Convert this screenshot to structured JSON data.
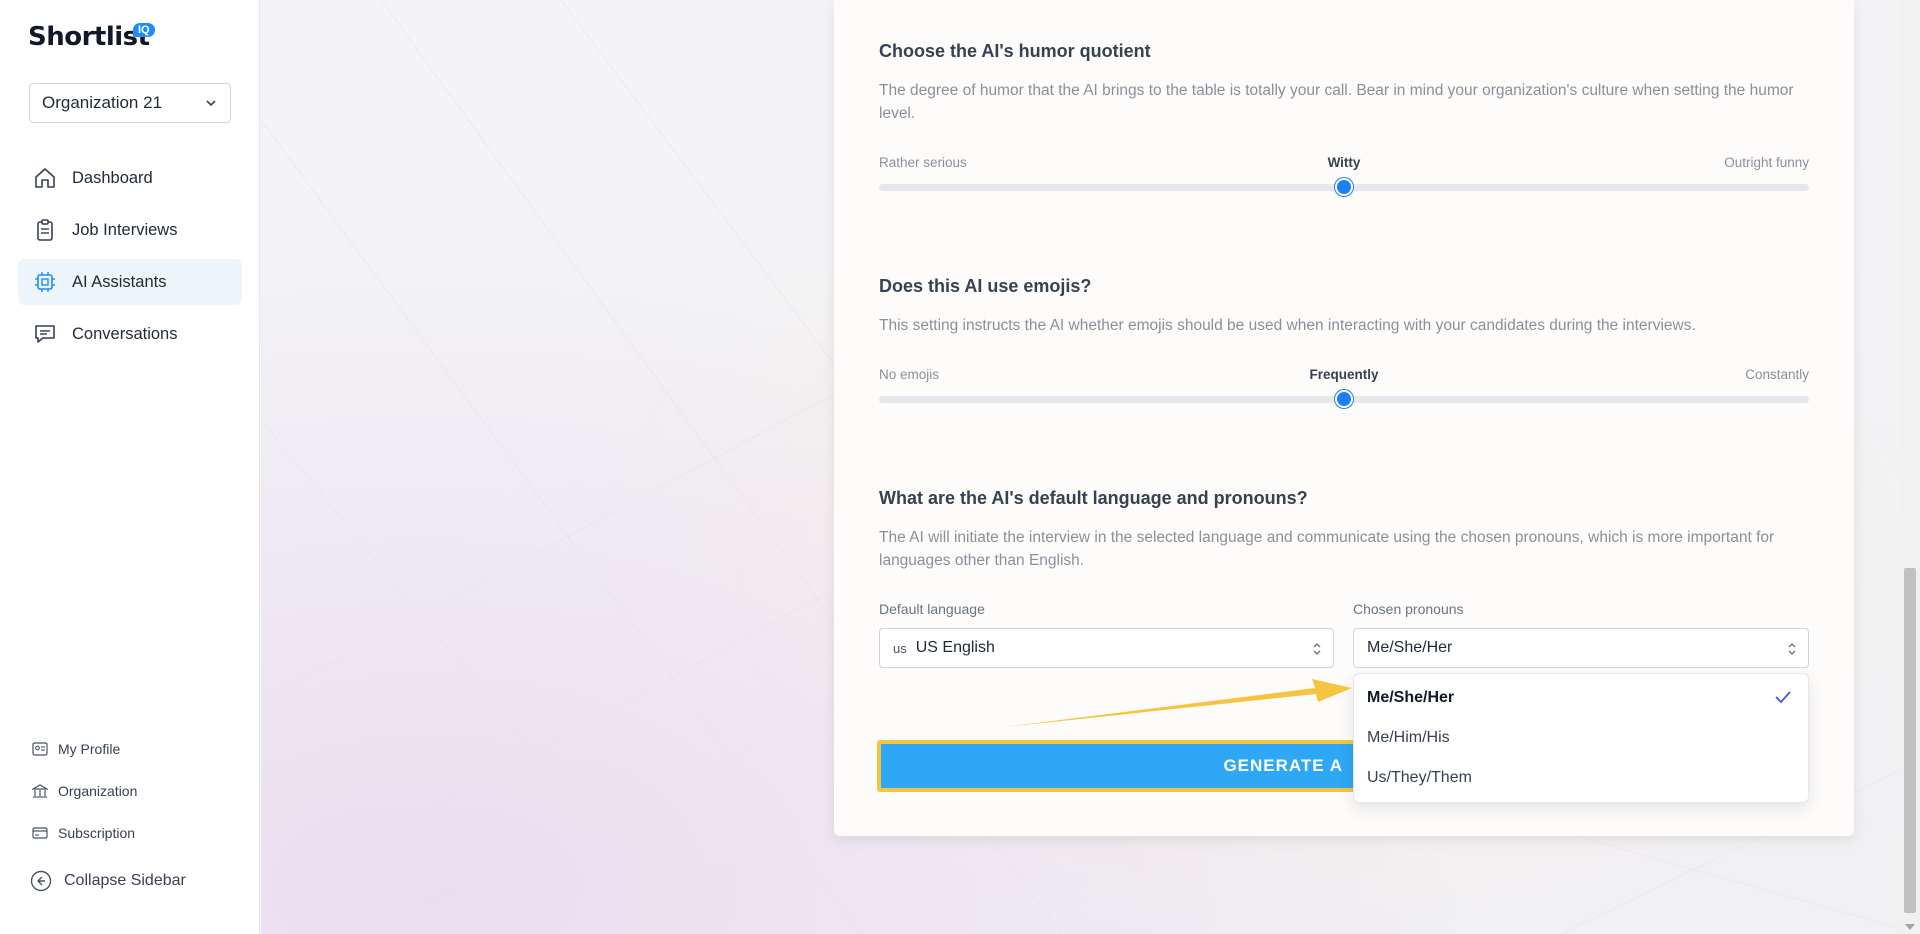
{
  "app": {
    "logo_text": "Shortlist",
    "logo_badge": "IQ"
  },
  "sidebar": {
    "org_selector": {
      "value": "Organization 21"
    },
    "items": [
      {
        "label": "Dashboard",
        "icon": "home-icon"
      },
      {
        "label": "Job Interviews",
        "icon": "clipboard-icon"
      },
      {
        "label": "AI Assistants",
        "icon": "chip-icon",
        "active": true
      },
      {
        "label": "Conversations",
        "icon": "chat-icon"
      }
    ],
    "bottom_items": [
      {
        "label": "My Profile",
        "icon": "id-card-icon"
      },
      {
        "label": "Organization",
        "icon": "building-icon"
      },
      {
        "label": "Subscription",
        "icon": "credit-card-icon"
      }
    ],
    "collapse_label": "Collapse Sidebar"
  },
  "humor": {
    "title": "Choose the AI's humor quotient",
    "description": "The degree of humor that the AI brings to the table is totally your call. Bear in mind your organization's culture when setting the humor level.",
    "min_label": "Rather serious",
    "current_label": "Witty",
    "max_label": "Outright funny",
    "value_fraction": 0.5
  },
  "emojis": {
    "title": "Does this AI use emojis?",
    "description": "This setting instructs the AI whether emojis should be used when interacting with your candidates during the interviews.",
    "min_label": "No emojis",
    "current_label": "Frequently",
    "max_label": "Constantly",
    "value_fraction": 0.5
  },
  "language": {
    "title": "What are the AI's default language and pronouns?",
    "description": "The AI will initiate the interview in the selected language and communicate using the chosen pronouns, which is more important for languages other than English.",
    "language_label": "Default language",
    "language_prefix": "us",
    "language_value": "US English",
    "pronouns_label": "Chosen pronouns",
    "pronouns_value": "Me/She/Her",
    "pronoun_options": [
      "Me/She/Her",
      "Me/Him/His",
      "Us/They/Them"
    ]
  },
  "generate_button": {
    "label": "GENERATE A"
  },
  "colors": {
    "accent": "#1d7ff5",
    "button": "#2ea8f5",
    "highlight": "#f5c542"
  }
}
